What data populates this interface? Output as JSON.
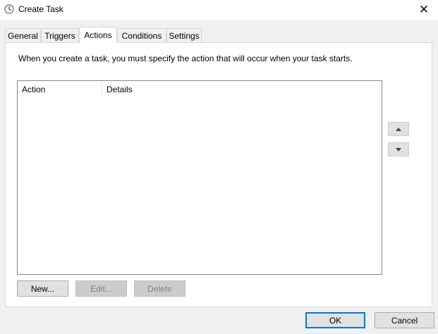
{
  "window": {
    "title": "Create Task",
    "icon": "clock-icon",
    "close_glyph": "✕"
  },
  "tabs": [
    {
      "label": "General",
      "active": false
    },
    {
      "label": "Triggers",
      "active": false
    },
    {
      "label": "Actions",
      "active": true
    },
    {
      "label": "Conditions",
      "active": false
    },
    {
      "label": "Settings",
      "active": false
    }
  ],
  "actions_panel": {
    "instruction": "When you create a task, you must specify the action that will occur when your task starts.",
    "columns": [
      "Action",
      "Details"
    ],
    "rows": [],
    "move_up_icon": "triangle-up-icon",
    "move_down_icon": "triangle-down-icon",
    "new_label": "New...",
    "edit_label": "Edit...",
    "delete_label": "Delete"
  },
  "footer": {
    "ok_label": "OK",
    "cancel_label": "Cancel"
  },
  "colors": {
    "accent": "#0078d7",
    "background": "#f0f0f0",
    "panel": "#ffffff"
  }
}
